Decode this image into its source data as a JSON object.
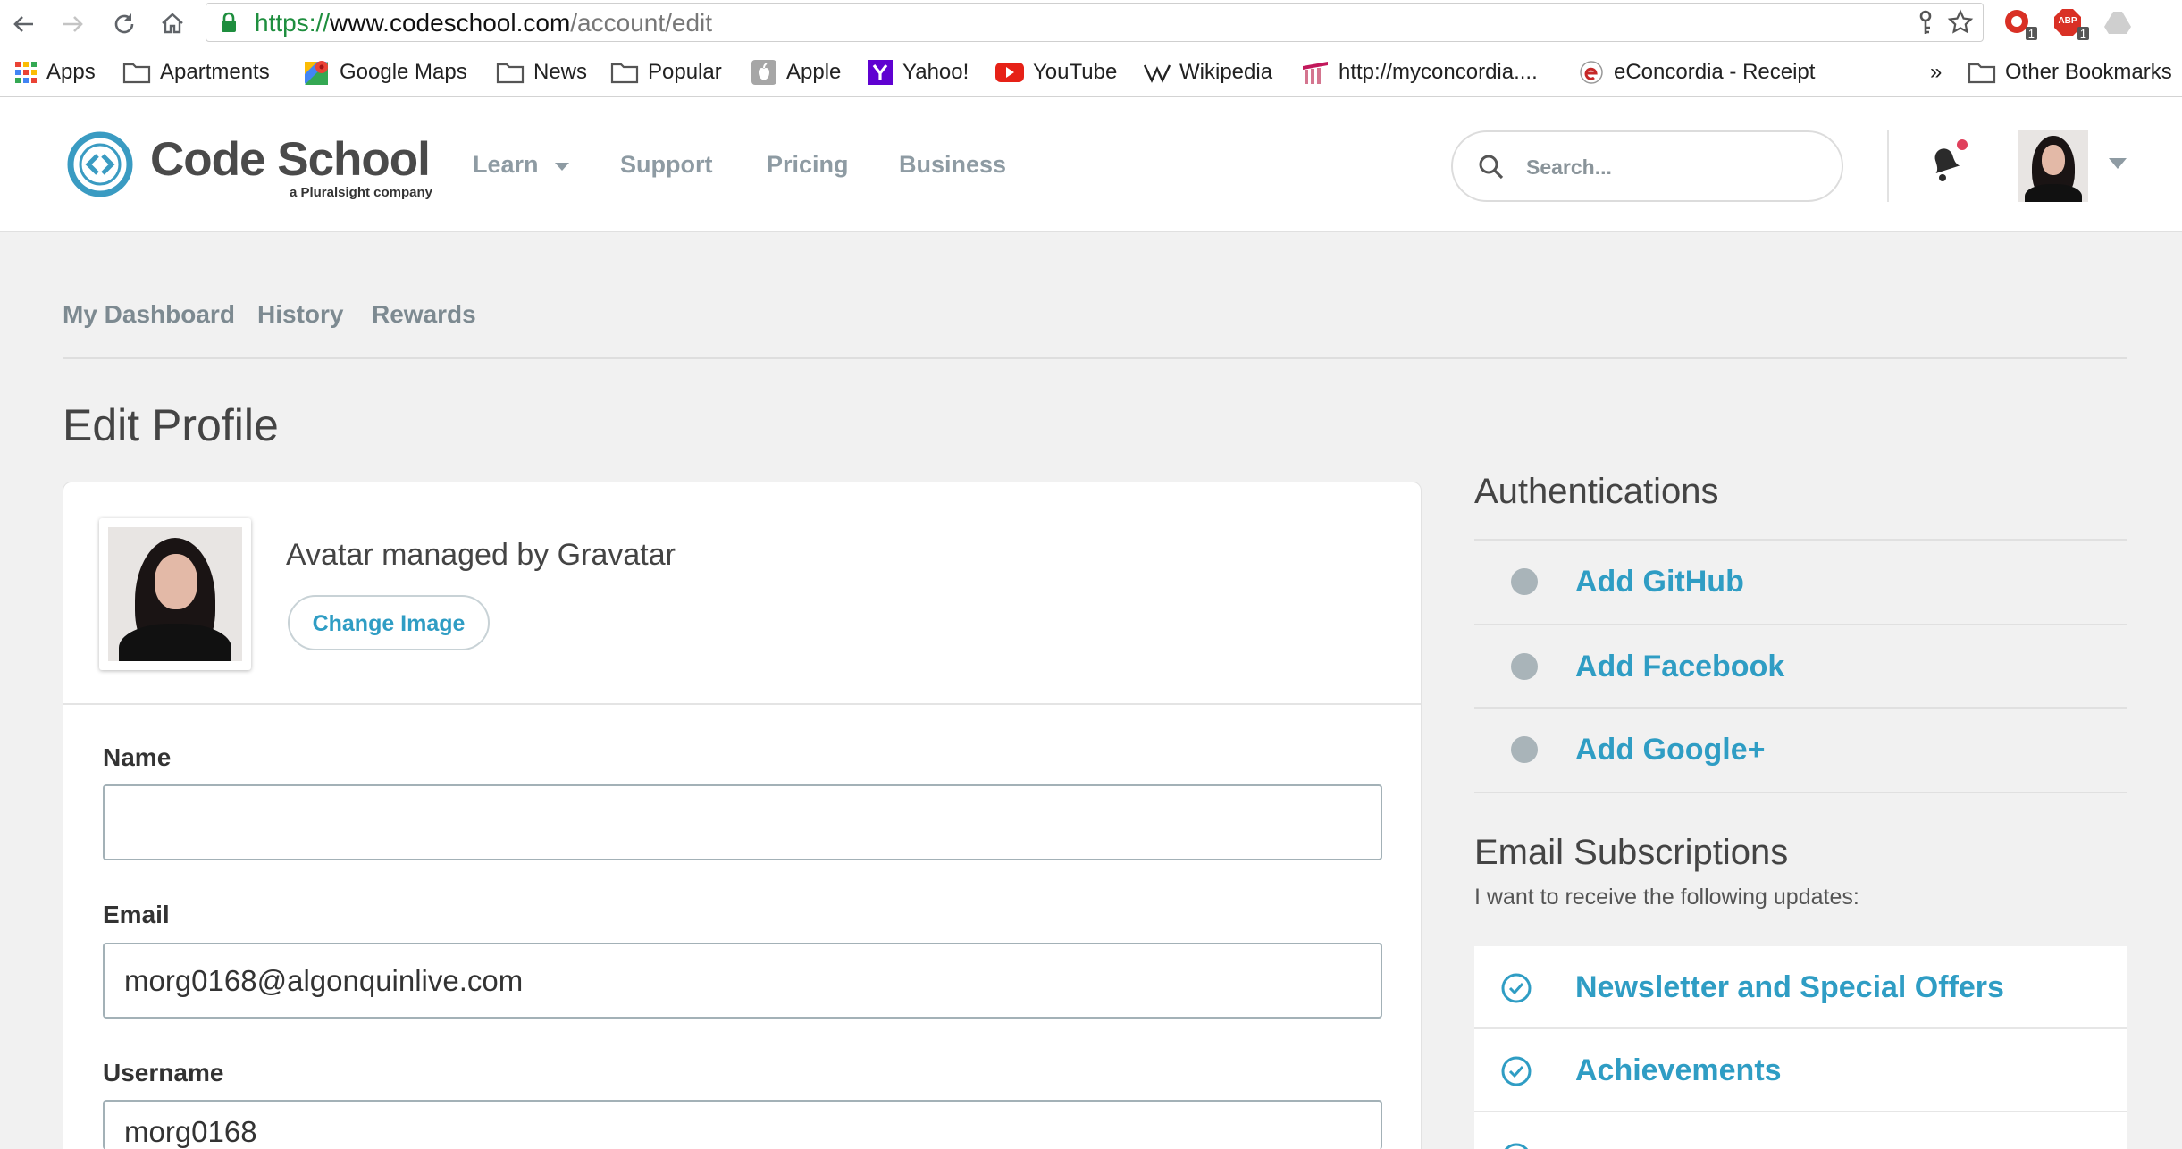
{
  "browser": {
    "url_scheme": "https://",
    "url_host": "www.codeschool.com",
    "url_path": "/account/edit",
    "extensions": [
      {
        "icon": "red-extension-icon",
        "badge": "1"
      },
      {
        "icon": "adblock-plus-icon",
        "label": "ABP",
        "badge": "1"
      },
      {
        "icon": "google-drive-icon"
      }
    ]
  },
  "bookmarks": [
    {
      "label": "Apps",
      "icon": "apps-grid-icon"
    },
    {
      "label": "Apartments",
      "icon": "folder-icon"
    },
    {
      "label": "Google Maps",
      "icon": "google-maps-icon"
    },
    {
      "label": "News",
      "icon": "folder-icon"
    },
    {
      "label": "Popular",
      "icon": "folder-icon"
    },
    {
      "label": "Apple",
      "icon": "apple-icon"
    },
    {
      "label": "Yahoo!",
      "icon": "yahoo-icon"
    },
    {
      "label": "YouTube",
      "icon": "youtube-icon"
    },
    {
      "label": "Wikipedia",
      "icon": "wikipedia-icon"
    },
    {
      "label": "http://myconcordia....",
      "icon": "myconcordia-icon"
    },
    {
      "label": "eConcordia - Receipt",
      "icon": "econcordia-icon"
    }
  ],
  "bookmarks_overflow": "»",
  "other_bookmarks": {
    "label": "Other Bookmarks",
    "icon": "folder-icon"
  },
  "site": {
    "logo_title": "Code School",
    "logo_subtitle": "a Pluralsight company",
    "nav": [
      {
        "label": "Learn",
        "has_dropdown": true
      },
      {
        "label": "Support"
      },
      {
        "label": "Pricing"
      },
      {
        "label": "Business"
      }
    ],
    "search_placeholder": "Search...",
    "has_unread_notification": true
  },
  "subnav": {
    "items": [
      "My Dashboard",
      "History",
      "Rewards"
    ]
  },
  "page_title": "Edit Profile",
  "profile": {
    "avatar_text": "Avatar managed by Gravatar",
    "change_image_label": "Change Image",
    "fields": [
      {
        "label": "Name",
        "value": ""
      },
      {
        "label": "Email",
        "value": "morg0168@algonquinlive.com"
      },
      {
        "label": "Username",
        "value": "morg0168"
      }
    ]
  },
  "authentications": {
    "title": "Authentications",
    "items": [
      "Add GitHub",
      "Add Facebook",
      "Add Google+"
    ]
  },
  "subscriptions": {
    "title": "Email Subscriptions",
    "subtitle": "I want to receive the following updates:",
    "items": [
      "Newsletter and Special Offers",
      "Achievements"
    ]
  },
  "colors": {
    "accent": "#2f9dc4",
    "nav_text": "#8e9ba3",
    "inactive_dot": "#a9b4b9",
    "notification_dot": "#e0405c",
    "secure_green": "#1e8e3e"
  }
}
